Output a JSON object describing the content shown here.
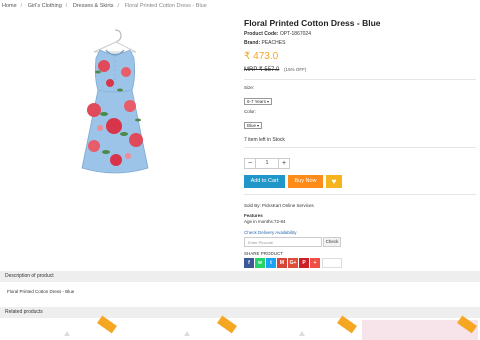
{
  "breadcrumb": [
    "Home",
    "Girl's Clothing",
    "Dresses & Skirts",
    "Floral Printed Cotton Dress - Blue"
  ],
  "product": {
    "title": "Floral Printed Cotton Dress - Blue",
    "code_label": "Product Code:",
    "code": "OPT-1867024",
    "brand_label": "Brand:",
    "brand": "PEACHES",
    "price": "₹ 473.0",
    "mrp": "MRP ₹ 557.0",
    "discount": "(15% OFF)",
    "size_label": "Size:",
    "size_value": "6-7 Years",
    "color_label": "Color:",
    "color_value": "Blue",
    "stock": "7 item left in Stock",
    "qty": "1",
    "sold_by": "Sold By: PicksKart Online Services",
    "features_heading": "Features",
    "features_value": "Age in months:72-84"
  },
  "actions": {
    "minus": "−",
    "plus": "+",
    "add_to_cart": "Add to Cart",
    "buy_now": "Buy Now",
    "wish_icon": "♥"
  },
  "delivery": {
    "label": "Check Delivery Availability",
    "placeholder": "Enter Pincode",
    "check": "Check"
  },
  "share": {
    "label": "SHARE PRODUCT",
    "items": [
      {
        "icon": "facebook-icon",
        "glyph": "f",
        "color": "#3b5998"
      },
      {
        "icon": "whatsapp-icon",
        "glyph": "w",
        "color": "#25d366"
      },
      {
        "icon": "twitter-icon",
        "glyph": "t",
        "color": "#1da1f2"
      },
      {
        "icon": "gmail-icon",
        "glyph": "M",
        "color": "#d44638"
      },
      {
        "icon": "google-plus-icon",
        "glyph": "G+",
        "color": "#dd4b39"
      },
      {
        "icon": "pinterest-icon",
        "glyph": "P",
        "color": "#cb2027"
      },
      {
        "icon": "more-share-icon",
        "glyph": "+",
        "color": "#f04e44"
      }
    ]
  },
  "sections": {
    "description_title": "Description of product",
    "description_text": "Floral Printed Cotton Dress - Blue",
    "related_title": "Related products"
  },
  "colors": {
    "accent_price": "#f5a623",
    "add_to_cart": "#2196c9",
    "buy_now": "#ff8c1a",
    "wishlist": "#f5b31c"
  }
}
